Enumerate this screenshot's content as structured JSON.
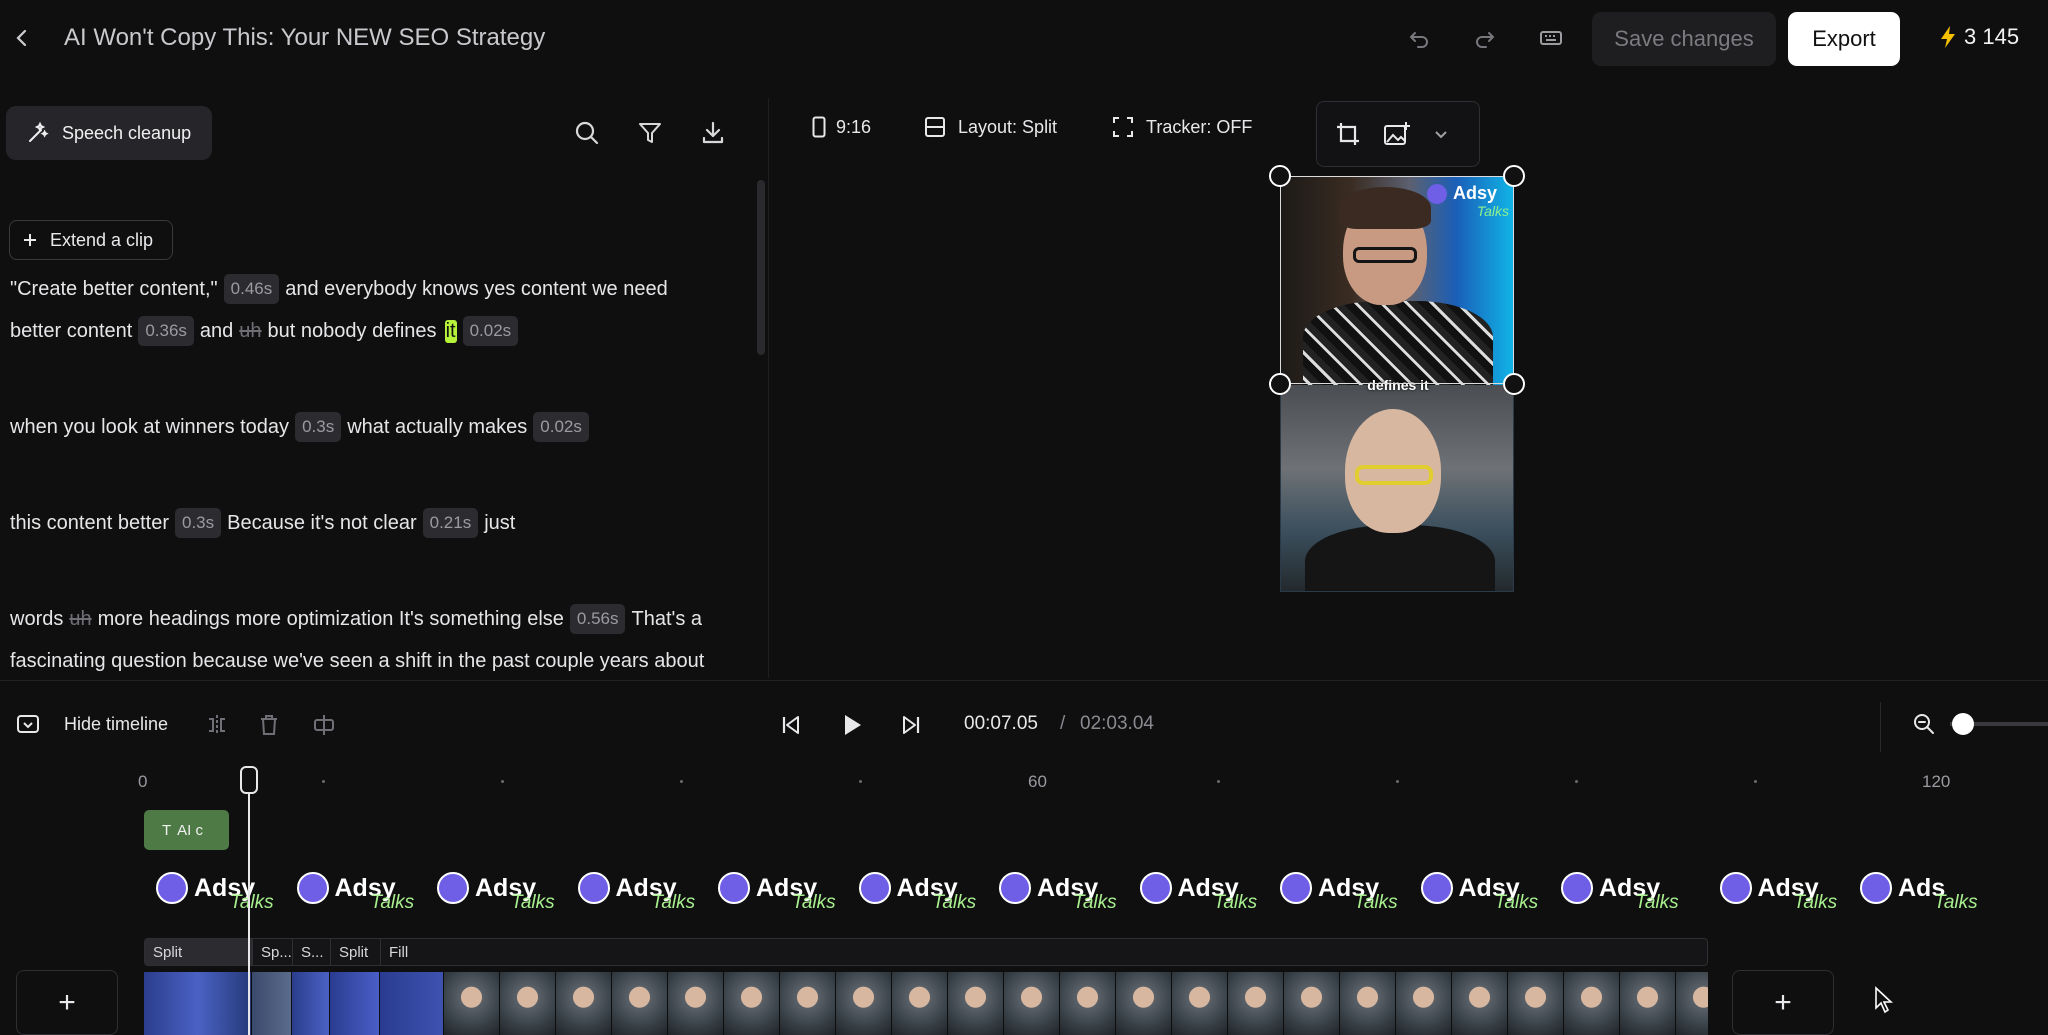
{
  "header": {
    "title": "AI Won't Copy This: Your NEW SEO Strategy",
    "save_label": "Save changes",
    "export_label": "Export",
    "credits": "3 145"
  },
  "left_panel": {
    "speech_cleanup_label": "Speech cleanup",
    "extend_clip_label": "Extend a clip",
    "transcript": {
      "l1a": "\"Create better content,\"",
      "p1": "0.46s",
      "l1b": "and everybody knows yes content we need",
      "l2a": "better content",
      "p2": "0.36s",
      "l2b": "and",
      "l2strike": "uh",
      "l2c": "but nobody defines",
      "l2hl": "it",
      "p3": "0.02s",
      "l3a": "when you look at winners today",
      "p4": "0.3s",
      "l3b": "what actually makes",
      "p5": "0.02s",
      "l4a": "this content better",
      "p6": "0.3s",
      "l4b": "Because it's not clear",
      "p7": "0.21s",
      "l4c": "just",
      "l5a": "words",
      "l5strike": "uh",
      "l5b": "more headings more optimization It's something else",
      "p8": "0.56s",
      "l5c": "That's a",
      "l6": "fascinating question because we've seen a shift in the past couple years about"
    }
  },
  "preview_toolbar": {
    "aspect": "9:16",
    "layout": "Layout: Split",
    "tracker": "Tracker: OFF"
  },
  "preview": {
    "brand": "Adsy",
    "brand_sub": "Talks",
    "caption": "defines it"
  },
  "timeline": {
    "hide_label": "Hide timeline",
    "current_time": "00:07.05",
    "separator": "/",
    "duration": "02:03.04",
    "ruler": [
      "0",
      "60",
      "120"
    ],
    "text_clip_label": "AI c",
    "logo_word": "Adsy",
    "logo_sub": "Talks",
    "logo_last": "Ads",
    "layout_segments": [
      "Split",
      "Sp...",
      "S...",
      "Split",
      "Fill"
    ],
    "add_label": "+"
  },
  "colors": {
    "accent_highlight": "#b6f23a",
    "text_clip": "#4e7a45",
    "brand_purple": "#6f5fe6",
    "credit_bolt": "#f5c000"
  }
}
